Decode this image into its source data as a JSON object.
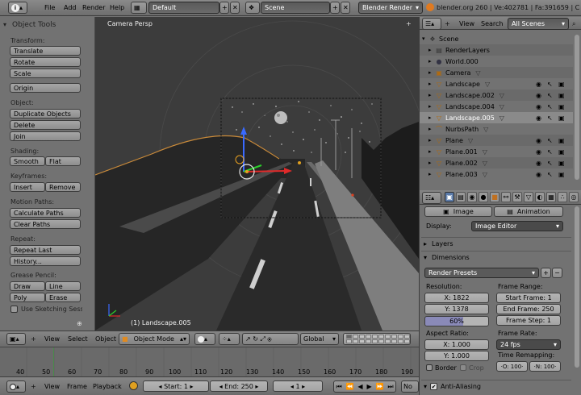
{
  "top": {
    "menus": [
      "File",
      "Add",
      "Render",
      "Help"
    ],
    "layout": "Default",
    "scene": "Scene",
    "engine": "Blender Render",
    "stats": "blender.org 260 | Ve:402781 | Fa:391659 | C"
  },
  "toolshelf": {
    "title": "Object Tools",
    "transform_label": "Transform:",
    "translate": "Translate",
    "rotate": "Rotate",
    "scale": "Scale",
    "origin": "Origin",
    "object_label": "Object:",
    "duplicate": "Duplicate Objects",
    "delete": "Delete",
    "join": "Join",
    "shading_label": "Shading:",
    "smooth": "Smooth",
    "flat": "Flat",
    "keyframes_label": "Keyframes:",
    "insert": "Insert",
    "remove": "Remove",
    "motion_label": "Motion Paths:",
    "calc_paths": "Calculate Paths",
    "clear_paths": "Clear Paths",
    "repeat_label": "Repeat:",
    "repeat_last": "Repeat Last",
    "history": "History...",
    "gp_label": "Grease Pencil:",
    "draw": "Draw",
    "line": "Line",
    "poly": "Poly",
    "erase": "Erase",
    "sketching": "Use Sketching Sessio"
  },
  "viewport": {
    "label": "Camera Persp",
    "object_name": "(1) Landscape.005"
  },
  "vpheader": {
    "view": "View",
    "select": "Select",
    "object": "Object",
    "mode": "Object Mode",
    "orientation": "Global"
  },
  "timeline": {
    "ticks": [
      "40",
      "50",
      "60",
      "70",
      "80",
      "90",
      "100",
      "110",
      "120",
      "130",
      "140",
      "150",
      "160",
      "170",
      "180",
      "190"
    ],
    "view": "View",
    "frame": "Frame",
    "playback": "Playback",
    "start": "Start: 1",
    "end": "End: 250",
    "current": "1",
    "no": "No"
  },
  "outliner": {
    "view": "View",
    "search": "Search",
    "filter": "All Scenes",
    "rows": [
      {
        "name": "Scene",
        "indent": 0
      },
      {
        "name": "RenderLayers",
        "indent": 1
      },
      {
        "name": "World.000",
        "indent": 1
      },
      {
        "name": "Camera",
        "indent": 1
      },
      {
        "name": "Landscape",
        "indent": 1
      },
      {
        "name": "Landscape.002",
        "indent": 1
      },
      {
        "name": "Landscape.004",
        "indent": 1
      },
      {
        "name": "Landscape.005",
        "indent": 1
      },
      {
        "name": "NurbsPath",
        "indent": 1
      },
      {
        "name": "Plane",
        "indent": 1
      },
      {
        "name": "Plane.001",
        "indent": 1
      },
      {
        "name": "Plane.002",
        "indent": 1
      },
      {
        "name": "Plane.003",
        "indent": 1
      }
    ]
  },
  "properties": {
    "image_btn": "Image",
    "animation_btn": "Animation",
    "display_label": "Display:",
    "display_value": "Image Editor",
    "layers": "Layers",
    "dimensions": "Dimensions",
    "presets": "Render Presets",
    "resolution_label": "Resolution:",
    "res_x": "X: 1822",
    "res_y": "Y: 1378",
    "res_pct": "60%",
    "frame_range_label": "Frame Range:",
    "start_frame": "Start Frame: 1",
    "end_frame": "End Frame: 250",
    "frame_step": "Frame Step: 1",
    "aspect_label": "Aspect Ratio:",
    "asp_x": "X: 1.000",
    "asp_y": "Y: 1.000",
    "framerate_label": "Frame Rate:",
    "fps": "24 fps",
    "remap_label": "Time Remapping:",
    "remap_old": "·O: 100·",
    "remap_new": "·N: 100·",
    "border": "Border",
    "crop": "Crop",
    "aa": "Anti-Aliasing"
  }
}
